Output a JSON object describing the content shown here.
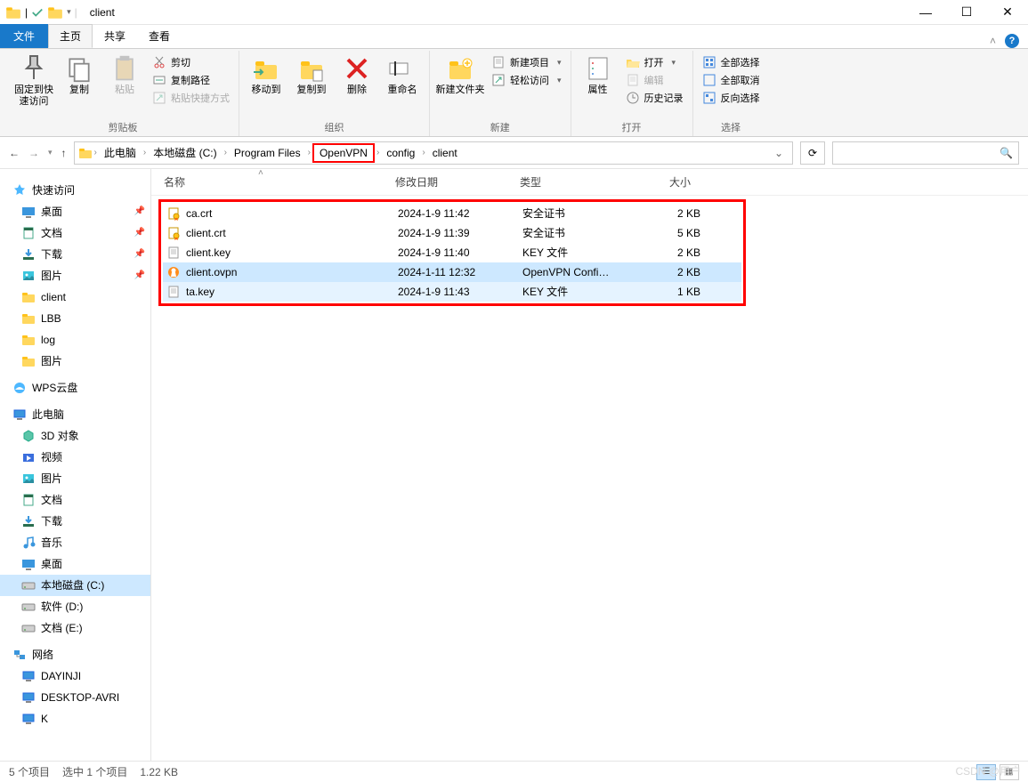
{
  "title": "client",
  "qat_sep": "|",
  "window_controls": {
    "min": "—",
    "max": "☐",
    "close": "✕"
  },
  "tabs": {
    "file": "文件",
    "home": "主页",
    "share": "共享",
    "view": "查看"
  },
  "ribbon": {
    "clipboard": {
      "pin": "固定到快速访问",
      "copy": "复制",
      "paste": "粘贴",
      "cut": "剪切",
      "copy_path": "复制路径",
      "paste_shortcut": "粘贴快捷方式",
      "label": "剪贴板"
    },
    "organize": {
      "move": "移动到",
      "copy_to": "复制到",
      "delete": "删除",
      "rename": "重命名",
      "label": "组织"
    },
    "new": {
      "new_folder": "新建文件夹",
      "new_item": "新建项目",
      "easy_access": "轻松访问",
      "label": "新建"
    },
    "open": {
      "properties": "属性",
      "open": "打开",
      "edit": "编辑",
      "history": "历史记录",
      "label": "打开"
    },
    "select": {
      "select_all": "全部选择",
      "select_none": "全部取消",
      "invert": "反向选择",
      "label": "选择"
    }
  },
  "breadcrumbs": [
    "此电脑",
    "本地磁盘 (C:)",
    "Program Files",
    "OpenVPN",
    "config",
    "client"
  ],
  "columns": {
    "name": "名称",
    "date": "修改日期",
    "type": "类型",
    "size": "大小"
  },
  "files": [
    {
      "name": "ca.crt",
      "date": "2024-1-9 11:42",
      "type": "安全证书",
      "size": "2 KB",
      "icon": "cert"
    },
    {
      "name": "client.crt",
      "date": "2024-1-9 11:39",
      "type": "安全证书",
      "size": "5 KB",
      "icon": "cert"
    },
    {
      "name": "client.key",
      "date": "2024-1-9 11:40",
      "type": "KEY 文件",
      "size": "2 KB",
      "icon": "file"
    },
    {
      "name": "client.ovpn",
      "date": "2024-1-11 12:32",
      "type": "OpenVPN Confi…",
      "size": "2 KB",
      "icon": "ovpn"
    },
    {
      "name": "ta.key",
      "date": "2024-1-9 11:43",
      "type": "KEY 文件",
      "size": "1 KB",
      "icon": "file"
    }
  ],
  "sidebar": {
    "quick_access": "快速访问",
    "quick_items": [
      {
        "label": "桌面",
        "icon": "desktop",
        "pin": true
      },
      {
        "label": "文档",
        "icon": "doc",
        "pin": true
      },
      {
        "label": "下载",
        "icon": "download",
        "pin": true
      },
      {
        "label": "图片",
        "icon": "pic",
        "pin": true
      },
      {
        "label": "client",
        "icon": "folder"
      },
      {
        "label": "LBB",
        "icon": "folder"
      },
      {
        "label": "log",
        "icon": "folder"
      },
      {
        "label": "图片",
        "icon": "folder"
      }
    ],
    "wps": "WPS云盘",
    "this_pc": "此电脑",
    "pc_items": [
      {
        "label": "3D 对象",
        "icon": "3d"
      },
      {
        "label": "视频",
        "icon": "video"
      },
      {
        "label": "图片",
        "icon": "pic"
      },
      {
        "label": "文档",
        "icon": "doc"
      },
      {
        "label": "下载",
        "icon": "download"
      },
      {
        "label": "音乐",
        "icon": "music"
      },
      {
        "label": "桌面",
        "icon": "desktop"
      },
      {
        "label": "本地磁盘 (C:)",
        "icon": "drive",
        "selected": true
      },
      {
        "label": "软件 (D:)",
        "icon": "drive"
      },
      {
        "label": "文档 (E:)",
        "icon": "drive"
      }
    ],
    "network": "网络",
    "net_items": [
      {
        "label": "DAYINJI",
        "icon": "pc"
      },
      {
        "label": "DESKTOP-AVRI",
        "icon": "pc"
      },
      {
        "label": "K",
        "icon": "pc"
      }
    ]
  },
  "status": {
    "count": "5 个项目",
    "selected": "选中 1 个项目",
    "size": "1.22 KB"
  },
  "watermark": "CSDN @用户"
}
